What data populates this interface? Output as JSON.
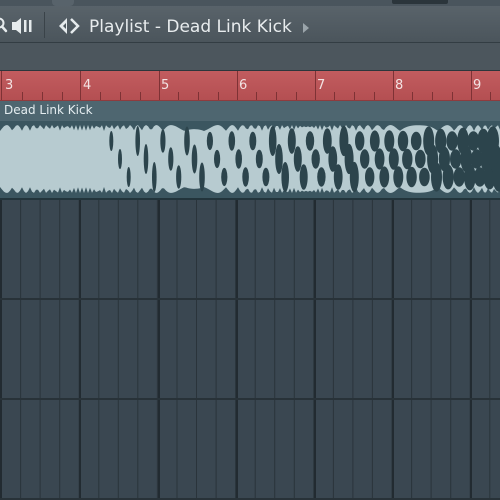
{
  "window": {
    "title": "Playlist - Dead Link Kick"
  },
  "icons": {
    "search": "magnifier-icon",
    "volume": "speaker-wave-icon",
    "arrows": "left-right-arrows-icon",
    "next": "triangle-right-icon"
  },
  "timeline": {
    "bars": [
      "3",
      "4",
      "5",
      "6",
      "7",
      "8",
      "9"
    ]
  },
  "clip": {
    "name": "Dead Link Kick"
  },
  "colors": {
    "ruler": "#c25c5f",
    "clip_header": "#4e6670",
    "clip_body": "#3b5660",
    "waveform": "#b7cbd0",
    "grid_bg": "#3a4751",
    "grid_line": "#2a343b"
  }
}
